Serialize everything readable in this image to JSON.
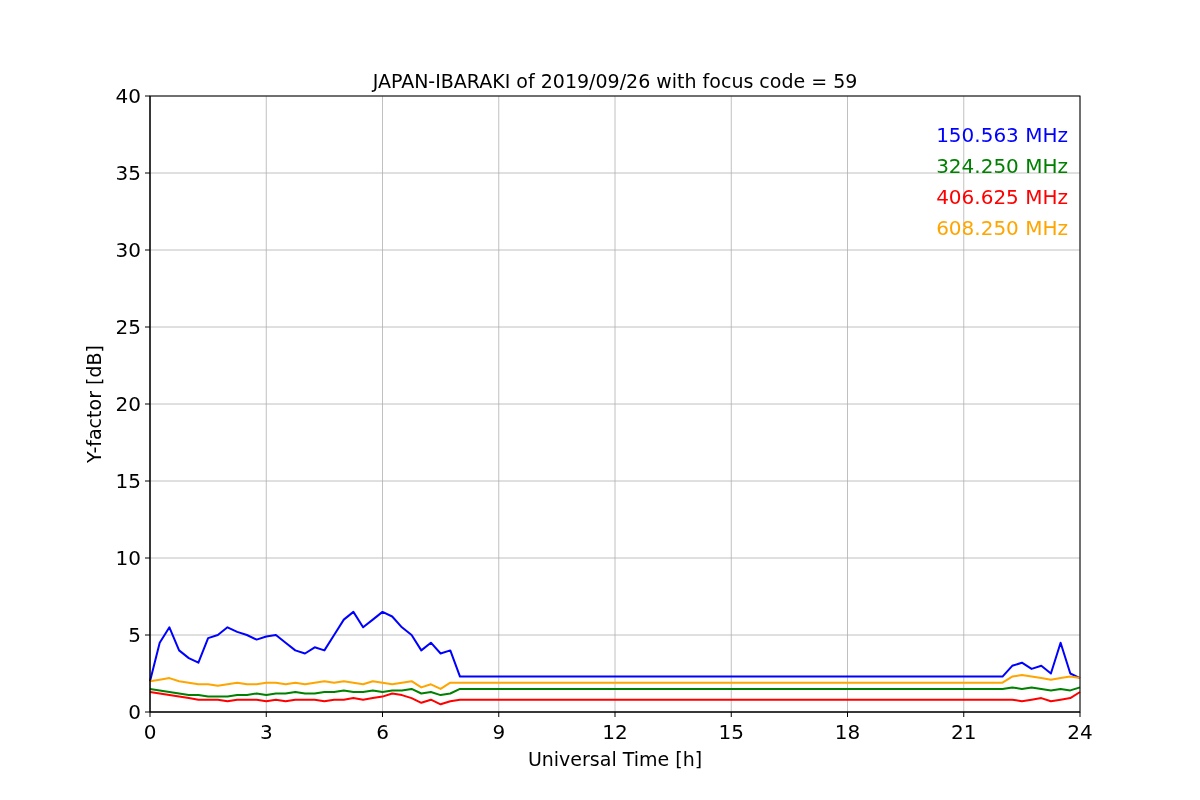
{
  "figure": {
    "chart_data": {
      "type": "line",
      "title": "JAPAN-IBARAKI of 2019/09/26 with focus code = 59",
      "xlabel": "Universal Time [h]",
      "ylabel": "Y-factor [dB]",
      "x": [
        0,
        0.25,
        0.5,
        0.75,
        1,
        1.25,
        1.5,
        1.75,
        2,
        2.25,
        2.5,
        2.75,
        3,
        3.25,
        3.5,
        3.75,
        4,
        4.25,
        4.5,
        4.75,
        5,
        5.25,
        5.5,
        5.75,
        6,
        6.25,
        6.5,
        6.75,
        7,
        7.25,
        7.5,
        7.75,
        8,
        22,
        22.25,
        22.5,
        22.75,
        23,
        23.25,
        23.5,
        23.75,
        24
      ],
      "series": [
        {
          "name": "150.563 MHz",
          "color": "#0000ff",
          "values": [
            2.0,
            4.5,
            5.5,
            4.0,
            3.5,
            3.2,
            4.8,
            5.0,
            5.5,
            5.2,
            5.0,
            4.7,
            4.9,
            5.0,
            4.5,
            4.0,
            3.8,
            4.2,
            4.0,
            5.0,
            6.0,
            6.5,
            5.5,
            6.0,
            6.5,
            6.2,
            5.5,
            5.0,
            4.0,
            4.5,
            3.8,
            4.0,
            2.3,
            2.3,
            3.0,
            3.2,
            2.8,
            3.0,
            2.5,
            4.5,
            2.5,
            2.2
          ]
        },
        {
          "name": "324.250 MHz",
          "color": "#008000",
          "values": [
            1.5,
            1.4,
            1.3,
            1.2,
            1.1,
            1.1,
            1.0,
            1.0,
            1.0,
            1.1,
            1.1,
            1.2,
            1.1,
            1.2,
            1.2,
            1.3,
            1.2,
            1.2,
            1.3,
            1.3,
            1.4,
            1.3,
            1.3,
            1.4,
            1.3,
            1.4,
            1.4,
            1.5,
            1.2,
            1.3,
            1.1,
            1.2,
            1.5,
            1.5,
            1.6,
            1.5,
            1.6,
            1.5,
            1.4,
            1.5,
            1.4,
            1.6
          ]
        },
        {
          "name": "406.625 MHz",
          "color": "#ff0000",
          "values": [
            1.3,
            1.2,
            1.1,
            1.0,
            0.9,
            0.8,
            0.8,
            0.8,
            0.7,
            0.8,
            0.8,
            0.8,
            0.7,
            0.8,
            0.7,
            0.8,
            0.8,
            0.8,
            0.7,
            0.8,
            0.8,
            0.9,
            0.8,
            0.9,
            1.0,
            1.2,
            1.1,
            0.9,
            0.6,
            0.8,
            0.5,
            0.7,
            0.8,
            0.8,
            0.8,
            0.7,
            0.8,
            0.9,
            0.7,
            0.8,
            0.9,
            1.3
          ]
        },
        {
          "name": "608.250 MHz",
          "color": "#ffa500",
          "values": [
            2.0,
            2.1,
            2.2,
            2.0,
            1.9,
            1.8,
            1.8,
            1.7,
            1.8,
            1.9,
            1.8,
            1.8,
            1.9,
            1.9,
            1.8,
            1.9,
            1.8,
            1.9,
            2.0,
            1.9,
            2.0,
            1.9,
            1.8,
            2.0,
            1.9,
            1.8,
            1.9,
            2.0,
            1.6,
            1.8,
            1.5,
            1.9,
            1.9,
            1.9,
            2.3,
            2.4,
            2.3,
            2.2,
            2.1,
            2.2,
            2.3,
            2.2
          ]
        }
      ],
      "xlim": [
        0,
        24
      ],
      "ylim": [
        0,
        40
      ],
      "grid": true,
      "xticks": [
        0,
        3,
        6,
        9,
        12,
        15,
        18,
        21,
        24
      ],
      "yticks": [
        0,
        5,
        10,
        15,
        20,
        25,
        30,
        35,
        40
      ]
    }
  }
}
